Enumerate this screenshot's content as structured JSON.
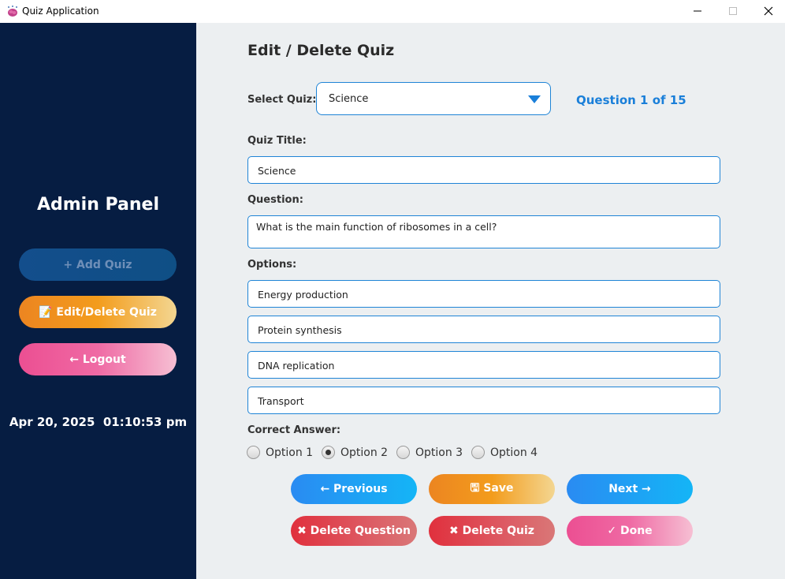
{
  "window": {
    "title": "Quiz Application",
    "icon": "brain-icon"
  },
  "sidebar": {
    "heading": "Admin Panel",
    "add_quiz_label": "+ Add Quiz",
    "edit_delete_label": "📝 Edit/Delete Quiz",
    "logout_label": "← Logout",
    "datetime": "Apr 20, 2025  01:10:53 pm"
  },
  "main": {
    "page_title": "Edit / Delete Quiz",
    "select_quiz_label": "Select Quiz:",
    "select_quiz_value": "Science",
    "question_counter": "Question 1 of 15",
    "quiz_title_label": "Quiz Title:",
    "quiz_title_value": "Science",
    "question_label": "Question:",
    "question_value": "What is the main function of ribosomes in a cell?",
    "options_label": "Options:",
    "options": [
      "Energy production",
      "Protein synthesis",
      "DNA replication",
      "Transport"
    ],
    "correct_answer_label": "Correct Answer:",
    "radio_options": [
      "Option 1",
      "Option 2",
      "Option 3",
      "Option 4"
    ],
    "selected_option": 2
  },
  "actions": {
    "previous": "← Previous",
    "save": "🖫 Save",
    "next": "Next →",
    "delete_question": "✖ Delete Question",
    "delete_quiz": "✖ Delete Quiz",
    "done": "✓ Done"
  },
  "colors": {
    "sidebar_bg": "#061d42",
    "accent_blue": "#1a7fd9",
    "main_bg": "#eceff1"
  }
}
